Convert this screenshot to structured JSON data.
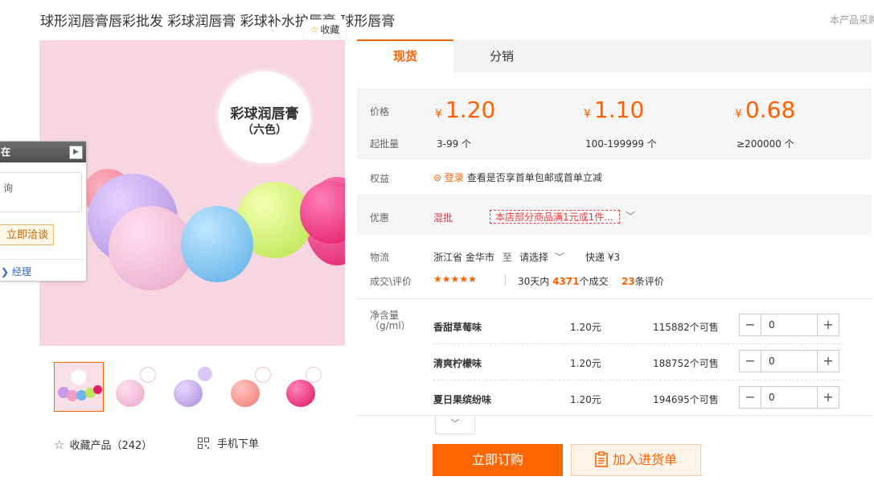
{
  "title": "球形润唇膏唇彩批发 彩球润唇膏 彩球补水护唇膏 球形唇膏",
  "top_note": "本产品采购",
  "favorite_btn": "收藏",
  "image_badge": {
    "line1": "彩球润唇膏",
    "line2": "（六色）"
  },
  "chat": {
    "header": "在线",
    "box_text": "询",
    "btn": "立即洽谈",
    "manager": "经理"
  },
  "tabs": [
    "现货",
    "分销"
  ],
  "price_label": "价格",
  "batch_label": "起批量",
  "currency": "¥",
  "tiers": [
    {
      "price": "1.20",
      "qty": "3-99 个"
    },
    {
      "price": "1.10",
      "qty": "100-199999 个"
    },
    {
      "price": "0.68",
      "qty": "≥200000 个"
    }
  ],
  "benefit": {
    "label": "权益",
    "link": "登录",
    "text": "查看是否享首单包邮或首单立减"
  },
  "promo": {
    "label": "优惠",
    "type": "混批",
    "tag": "本店部分商品满1元或1件..."
  },
  "logistics": {
    "label": "物流",
    "from": "浙江省 金华市",
    "to_word": "至",
    "select": "请选择",
    "shipping": "快递 ¥3"
  },
  "deals": {
    "label": "成交\\评价",
    "stars": "★★★★★",
    "days": "30天内",
    "count": "4371",
    "count_unit": "个成交",
    "reviews": "23",
    "reviews_unit": "条评价"
  },
  "spec_label": "净含量\n（g/ml）",
  "skus": [
    {
      "name": "香甜草莓味",
      "price": "1.20元",
      "stock": "115882个可售",
      "qty": "0"
    },
    {
      "name": "清爽柠檬味",
      "price": "1.20元",
      "stock": "188752个可售",
      "qty": "0"
    },
    {
      "name": "夏日果缤纷味",
      "price": "1.20元",
      "stock": "194695个可售",
      "qty": "0"
    }
  ],
  "stepper": {
    "minus": "−",
    "plus": "+"
  },
  "more_icon": "chevron-down",
  "buy_btn": "立即订购",
  "cart_btn": "加入进货单",
  "fav_product": "收藏产品（242）",
  "mobile_order": "手机下单",
  "colors": {
    "accent": "#ff6000",
    "price": "#ff6000",
    "promo_red": "#e4393c"
  }
}
